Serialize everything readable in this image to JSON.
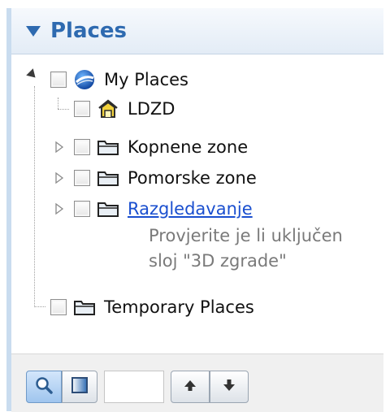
{
  "panel": {
    "title": "Places",
    "colors": {
      "header_text": "#2e6ab0",
      "link": "#1a4fcf",
      "sub_text": "#7a7a7a"
    }
  },
  "tree": {
    "root": {
      "label": "My Places",
      "icon": "earth-globe-icon",
      "expanded": true
    },
    "children": [
      {
        "label": "LDZD",
        "icon": "home-icon",
        "has_children": false
      },
      {
        "label": "Kopnene zone",
        "icon": "folder-icon",
        "has_children": true
      },
      {
        "label": "Pomorske zone",
        "icon": "folder-icon",
        "has_children": true
      },
      {
        "label": "Razgledavanje",
        "icon": "folder-icon",
        "has_children": true,
        "is_link": true,
        "description_line1": "Provjerite je li uključen",
        "description_line2": "sloj \"3D zgrade\""
      }
    ],
    "temporary": {
      "label": "Temporary Places",
      "icon": "folder-icon"
    }
  },
  "toolbar": {
    "search_icon": "magnifier-icon",
    "panel_icon": "panel-view-icon",
    "field_value": "",
    "up_icon": "arrow-up-icon",
    "down_icon": "arrow-down-icon"
  }
}
